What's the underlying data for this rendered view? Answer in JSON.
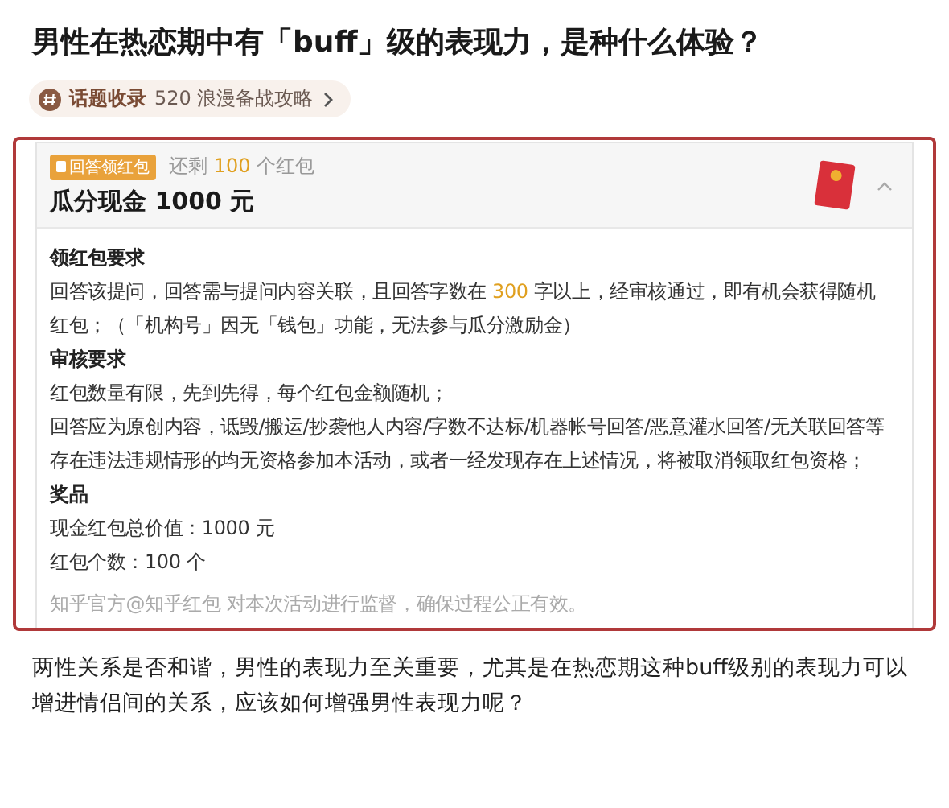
{
  "question": {
    "title": "男性在热恋期中有「buff」级的表现力，是种什么体验？"
  },
  "topic_chip": {
    "label": "话题收录",
    "name": "520 浪漫备战攻略"
  },
  "red_packet": {
    "badge": "回答领红包",
    "remaining": [
      {
        "text": "还剩 ",
        "highlight": false
      },
      {
        "text": "100",
        "highlight": true
      },
      {
        "text": " 个红包",
        "highlight": false
      }
    ],
    "title": "瓜分现金 1000 元",
    "expanded": true,
    "sections": [
      {
        "heading": "领红包要求",
        "paragraphs": [
          [
            {
              "text": "回答该提问，回答需与提问内容关联，且回答字数在 ",
              "highlight": false
            },
            {
              "text": "300",
              "highlight": true
            },
            {
              "text": " 字以上，经审核通过，即有机会获得随机红包；（「机构号」因无「钱包」功能，无法参与瓜分激励金）",
              "highlight": false
            }
          ]
        ]
      },
      {
        "heading": "审核要求",
        "paragraphs": [
          [
            {
              "text": "红包数量有限，先到先得，每个红包金额随机；",
              "highlight": false
            }
          ],
          [
            {
              "text": "回答应为原创内容，诋毁/搬运/抄袭他人内容/字数不达标/机器帐号回答/恶意灌水回答/无关联回答等存在违法违规情形的均无资格参加本活动，或者一经发现存在上述情况，将被取消领取红包资格；",
              "highlight": false
            }
          ]
        ]
      },
      {
        "heading": "奖品",
        "paragraphs": [
          [
            {
              "text": "现金红包总价值：1000 元",
              "highlight": false
            }
          ],
          [
            {
              "text": "红包个数：100 个",
              "highlight": false
            }
          ]
        ]
      }
    ],
    "footnote": "知乎官方@知乎红包 对本次活动进行监督，确保过程公正有效。"
  },
  "intro": "两性关系是否和谐，男性的表现力至关重要，尤其是在热恋期这种buff级别的表现力可以增进情侣间的关系，应该如何增强男性表现力呢？"
}
